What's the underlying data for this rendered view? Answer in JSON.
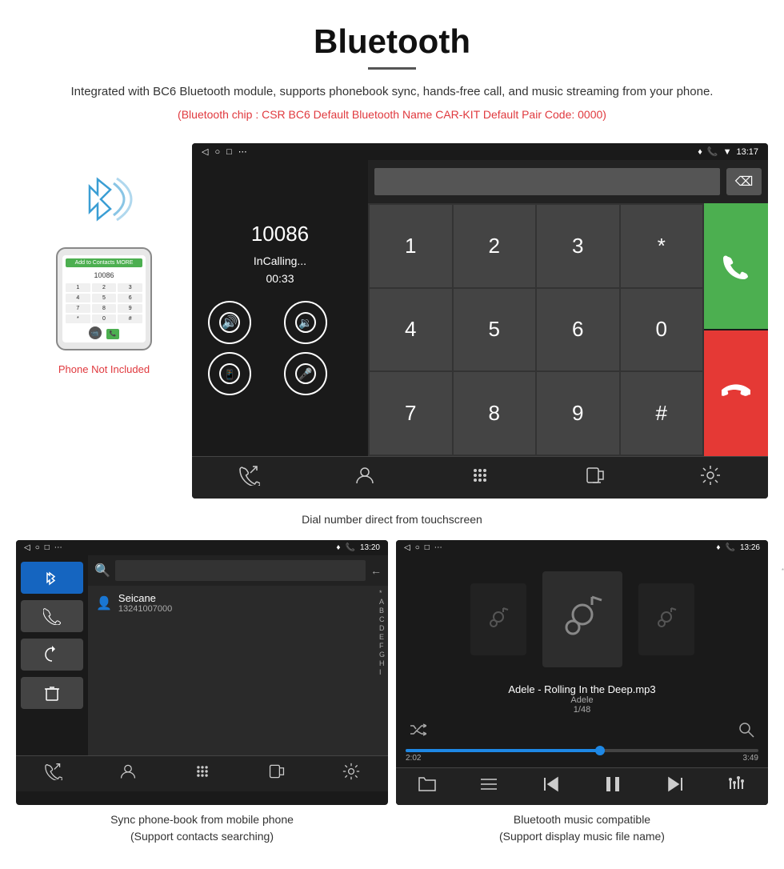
{
  "header": {
    "title": "Bluetooth",
    "description": "Integrated with BC6 Bluetooth module, supports phonebook sync, hands-free call, and music streaming from your phone.",
    "specs": "(Bluetooth chip : CSR BC6    Default Bluetooth Name CAR-KIT    Default Pair Code: 0000)"
  },
  "top_screen": {
    "statusbar": {
      "nav_back": "◁",
      "nav_circle": "○",
      "nav_square": "□",
      "nav_dots": "⋯",
      "location_icon": "📍",
      "phone_icon": "📞",
      "wifi_icon": "▼",
      "time": "13:17"
    },
    "dial_number": "10086",
    "status": "InCalling...",
    "timer": "00:33",
    "numpad": [
      "1",
      "2",
      "3",
      "*",
      "4",
      "5",
      "6",
      "0",
      "7",
      "8",
      "9",
      "#"
    ]
  },
  "top_caption": "Dial number direct from touchscreen",
  "phone": {
    "not_included": "Phone Not Included"
  },
  "bottom_left": {
    "statusbar_time": "13:20",
    "contact_name": "Seicane",
    "contact_number": "13241007000",
    "alphabet": [
      "*",
      "A",
      "B",
      "C",
      "D",
      "E",
      "F",
      "G",
      "H",
      "I"
    ]
  },
  "bottom_right": {
    "statusbar_time": "13:26",
    "song_title": "Adele - Rolling In the Deep.mp3",
    "artist": "Adele",
    "track_count": "1/48",
    "time_current": "2:02",
    "time_total": "3:49",
    "progress_percent": 55
  },
  "bottom_left_caption": "Sync phone-book from mobile phone\n(Support contacts searching)",
  "bottom_right_caption": "Bluetooth music compatible\n(Support display music file name)"
}
